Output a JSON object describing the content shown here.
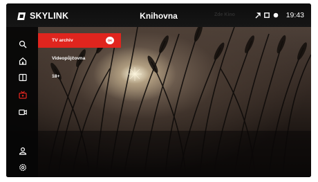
{
  "header": {
    "logo_text": "SKYLINK",
    "title": "Knihovna",
    "faint_badge": "Zde Kino",
    "time": "19:43",
    "status_icons": [
      "tool-icon",
      "square-icon",
      "dot-icon"
    ]
  },
  "rail": {
    "icons": [
      "search-icon",
      "home-icon",
      "book-icon",
      "tv-red-icon",
      "video-camera-icon",
      "user-icon",
      "settings-icon"
    ],
    "accent": "#e0251e"
  },
  "menu": {
    "items": [
      {
        "label": "TV archiv",
        "badge": "OK",
        "active": true
      },
      {
        "label": "Videopůjčovna",
        "active": false
      },
      {
        "label": "18+",
        "active": false
      }
    ]
  },
  "colors": {
    "accent": "#e0251e",
    "header_bg": "#111111"
  }
}
